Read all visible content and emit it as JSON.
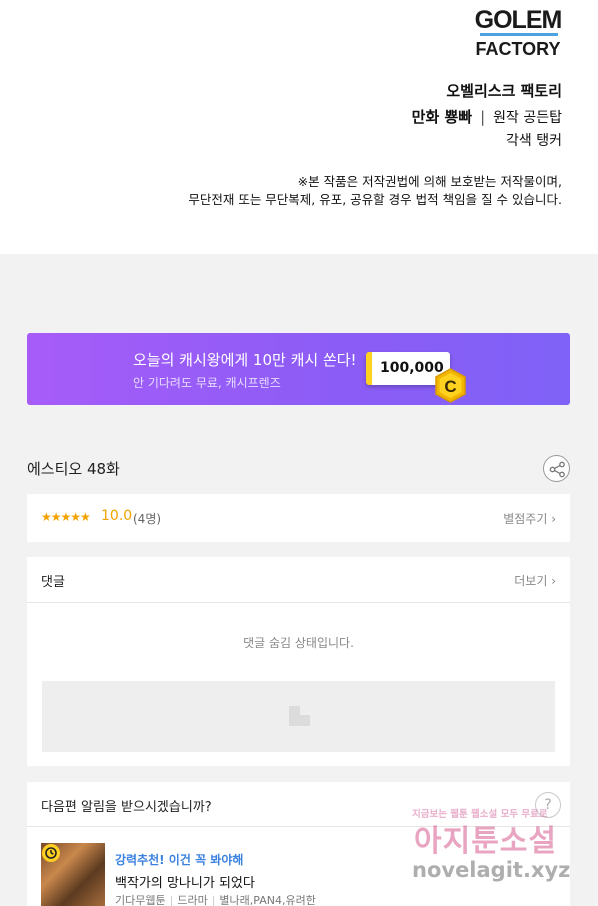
{
  "credits": {
    "logo_lines": [
      "GOLEM",
      "FACTORY"
    ],
    "studio": "오벨리스크 팩토리",
    "manhwa_label": "만화 뿅빠",
    "separator": "|",
    "original_label": "원작 공든탑",
    "adaptation": "각색 탱커",
    "notice_line1": "※본 작품은 저작권법에 의해 보호받는 저작물이며,",
    "notice_line2": "무단전재 또는 무단복제, 유포, 공유할 경우 법적 책임을 질 수 있습니다."
  },
  "banner": {
    "title": "오늘의 캐시왕에게 10만 캐시 쏜다!",
    "subtitle": "안 기다려도 무료, 캐시프렌즈",
    "cash_amount": "100,000",
    "coin_letter": "C",
    "gradient_colors": [
      "#a75cf8",
      "#7f62f7"
    ]
  },
  "episode": {
    "title": "에스티오 48화",
    "share_icon": "share-icon"
  },
  "rating": {
    "stars": "★★★★★",
    "score": "10.0",
    "count": "(4명)",
    "rate_link": "별점주기 ›",
    "star_color": "#f3a200"
  },
  "comments": {
    "header": "댓글",
    "more_link": "더보기 ›",
    "hidden_message": "댓글 숨김 상태입니다."
  },
  "next_alert": {
    "question": "다음편 알림을 받으시겠습니까?",
    "help_symbol": "?",
    "recommend_label": "강력추천! 이건 꼭 봐야해",
    "recommend_title": "백작가의 망나니가 되었다",
    "meta": [
      "기다무웹툰",
      "드라마",
      "별나래,PAN4,유려한"
    ],
    "label_color": "#3b82e0"
  },
  "watermark": {
    "top_text": "지금보는 웹툰 웹소설 모두 무료로",
    "site_name": "아지툰소설",
    "domain": "novelagit.xyz"
  }
}
